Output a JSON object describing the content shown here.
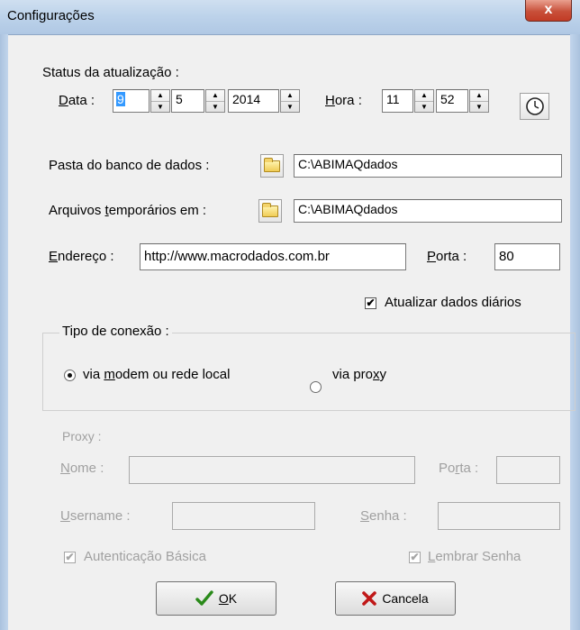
{
  "window": {
    "title": "Configurações",
    "close_glyph": "x"
  },
  "status": {
    "label": "Status da atualização :",
    "data_label_u": "D",
    "data_label_rest": "ata :",
    "day": "9",
    "month": "5",
    "year": "2014",
    "hora_label_u": "H",
    "hora_label_rest": "ora :",
    "hour": "11",
    "minute": "52"
  },
  "pasta": {
    "label": "Pasta do banco de dados :",
    "value": "C:\\ABIMAQdados"
  },
  "temp": {
    "label_a": "Arquivos ",
    "label_u": "t",
    "label_b": "emporários em :",
    "value": "C:\\ABIMAQdados"
  },
  "endereco": {
    "label_u": "E",
    "label_rest": "ndereço :",
    "value": "http://www.macrodados.com.br"
  },
  "porta": {
    "label_u": "P",
    "label_rest": "orta :",
    "value": "80"
  },
  "atualizar": {
    "label": "Atualizar dados diários",
    "checked": "✔"
  },
  "conexao": {
    "legend": "Tipo de conexão :",
    "opt1_a": "via ",
    "opt1_u": "m",
    "opt1_b": "odem ou rede local",
    "opt2_a": "via pro",
    "opt2_u": "x",
    "opt2_b": "y"
  },
  "proxy": {
    "label": "Proxy :",
    "nome_u": "N",
    "nome_rest": "ome :",
    "porta_a": "Po",
    "porta_u": "r",
    "porta_b": "ta :",
    "user_u": "U",
    "user_rest": "sername :",
    "senha_u": "S",
    "senha_rest": "enha :",
    "auth_label": "Autenticação Básica",
    "lembrar_u": "L",
    "lembrar_rest": "embrar Senha",
    "check_mark": "✔"
  },
  "buttons": {
    "ok_u": "O",
    "ok_rest": "K",
    "cancel": "Cancela"
  },
  "icons": {
    "ok": "check-icon",
    "cancel": "x-icon",
    "clock": "clock-icon",
    "folder": "folder-icon"
  },
  "colors": {
    "ok_green": "#2a8a1a",
    "cancel_red": "#c01818",
    "selected_day_bg": "#3399ff"
  }
}
